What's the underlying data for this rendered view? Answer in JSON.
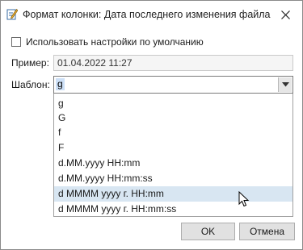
{
  "window": {
    "title": "Формат колонки: Дата последнего изменения файла",
    "title_icon": "edit-format-icon",
    "close_icon": "close-icon"
  },
  "use_defaults": {
    "label": "Использовать настройки по умолчанию",
    "checked": false
  },
  "sample": {
    "label": "Пример:",
    "value": "01.04.2022 11:27"
  },
  "template": {
    "label": "Шаблон:",
    "value": "g",
    "caret_icon": "chevron-down-icon"
  },
  "dropdown": {
    "options": [
      "g",
      "G",
      "f",
      "F",
      "d.MM.yyyy HH:mm",
      "d.MM.yyyy HH:mm:ss",
      "d MMMM yyyy г. HH:mm",
      "d MMMM yyyy г. HH:mm:ss"
    ],
    "hovered_index": 6
  },
  "buttons": {
    "ok": "OK",
    "cancel": "Отмена"
  },
  "colors": {
    "selection": "#cde0f7",
    "hover": "#d8e6f2",
    "button_bg": "#e1e1e1"
  }
}
